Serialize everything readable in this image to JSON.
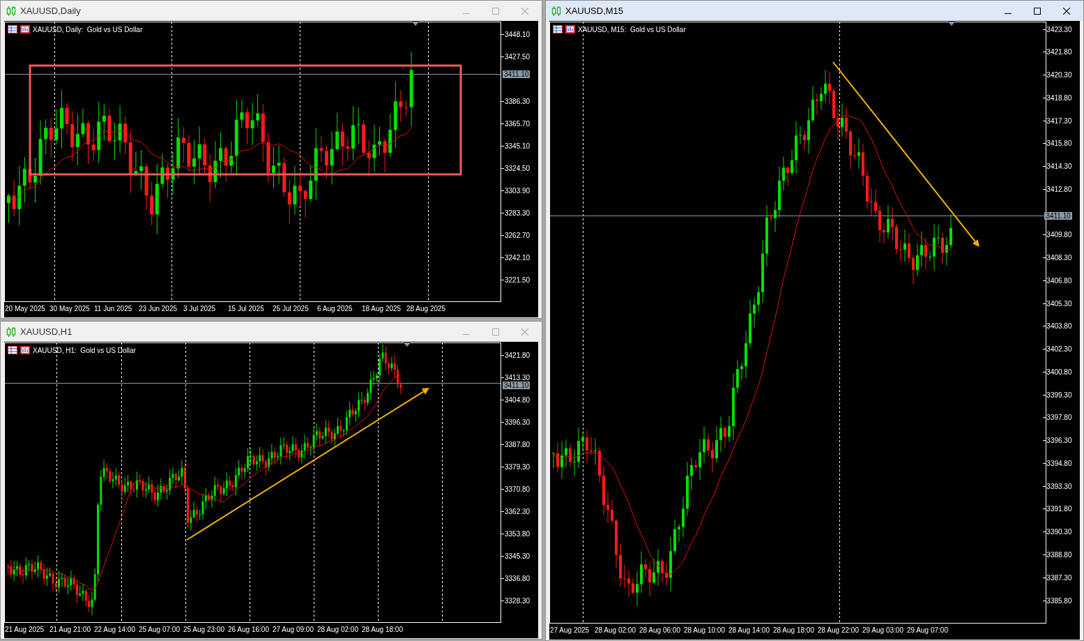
{
  "windows": [
    {
      "title": "XAUUSD,Daily",
      "active": false,
      "legend": "XAUUSD, Daily:  Gold vs US Dollar",
      "current_price": "3411.10",
      "price_ticks": [
        "3448.10",
        "3427.50",
        "3386.30",
        "3365.70",
        "3345.10",
        "3324.50",
        "3303.90",
        "3283.30",
        "3262.70",
        "3242.10",
        "3221.50"
      ],
      "time_labels": [
        "20 May 2025",
        "30 May 2025",
        "11 Jun 2025",
        "23 Jun 2025",
        "3 Jul 2025",
        "15 Jul 2025",
        "25 Jul 2025",
        "6 Aug 2025",
        "18 Aug 2025",
        "28 Aug 2025"
      ],
      "drawings": [
        {
          "kind": "rectangle"
        }
      ]
    },
    {
      "title": "XAUUSD,H1",
      "active": false,
      "legend": "XAUUSD, H1:  Gold vs US Dollar",
      "current_price": "3411.10",
      "price_ticks": [
        "3421.80",
        "3413.30",
        "3404.80",
        "3396.30",
        "3387.80",
        "3379.30",
        "3370.80",
        "3362.30",
        "3353.80",
        "3345.30",
        "3336.80",
        "3328.30"
      ],
      "time_labels": [
        "21 Aug 2025",
        "21 Aug 21:00",
        "22 Aug 14:00",
        "25 Aug 07:00",
        "25 Aug 23:00",
        "26 Aug 16:00",
        "27 Aug 09:00",
        "28 Aug 02:00",
        "28 Aug 18:00"
      ],
      "drawings": [
        {
          "kind": "arrow"
        }
      ]
    },
    {
      "title": "XAUUSD,M15",
      "active": true,
      "legend": "XAUUSD, M15:  Gold vs US Dollar",
      "current_price": "3411.10",
      "price_ticks": [
        "3423.30",
        "3421.80",
        "3420.30",
        "3418.80",
        "3417.30",
        "3415.80",
        "3414.30",
        "3412.80",
        "3409.80",
        "3408.30",
        "3406.80",
        "3405.30",
        "3403.80",
        "3402.30",
        "3400.80",
        "3399.30",
        "3397.80",
        "3396.30",
        "3394.80",
        "3393.30",
        "3391.80",
        "3390.30",
        "3388.80",
        "3387.30",
        "3385.80"
      ],
      "time_labels": [
        "27 Aug 2025",
        "28 Aug 02:00",
        "28 Aug 06:00",
        "28 Aug 10:00",
        "28 Aug 14:00",
        "28 Aug 18:00",
        "28 Aug 22:00",
        "29 Aug 03:00",
        "29 Aug 07:00"
      ],
      "drawings": [
        {
          "kind": "arrow"
        }
      ]
    }
  ]
}
